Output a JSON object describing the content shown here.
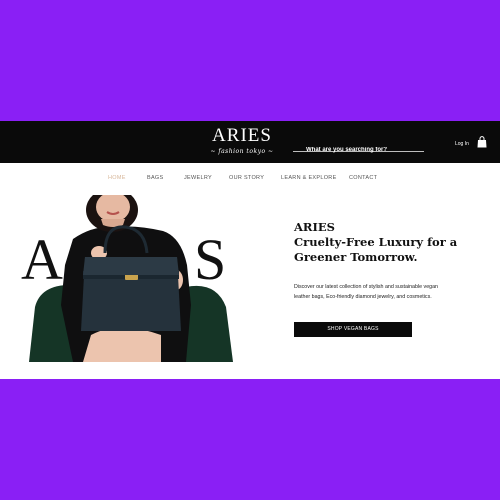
{
  "brand": {
    "name": "ARIES",
    "tagline": "~ fashion tokyo ~"
  },
  "header": {
    "search_placeholder": "What are you searching for?",
    "login_label": "Log In",
    "icons": {
      "cart": "shopping-bag-icon"
    }
  },
  "nav": {
    "items": [
      {
        "label": "HOME",
        "active": true
      },
      {
        "label": "BAGS",
        "active": false
      },
      {
        "label": "JEWELRY",
        "active": false
      },
      {
        "label": "OUR STORY",
        "active": false
      },
      {
        "label": "LEARN & EXPLORE",
        "active": false
      },
      {
        "label": "CONTACT",
        "active": false
      }
    ]
  },
  "hero": {
    "image_letters": "ARIES",
    "headline_line1": "ARIES",
    "headline_line2": "Cruelty-Free Luxury for a",
    "headline_line3": "Greener Tomorrow.",
    "description_line1": "Discover our latest collection of stylish and sustainable vegan",
    "description_line2": "leather bags, Eco-friendly diamond jewelry, and cosmetics.",
    "cta_label": "SHOP VEGAN BAGS"
  },
  "colors": {
    "page_background": "#8a1ff5",
    "header_background": "#0a0a0a",
    "nav_active": "#d7b79a",
    "cta_background": "#0a0a0a"
  }
}
